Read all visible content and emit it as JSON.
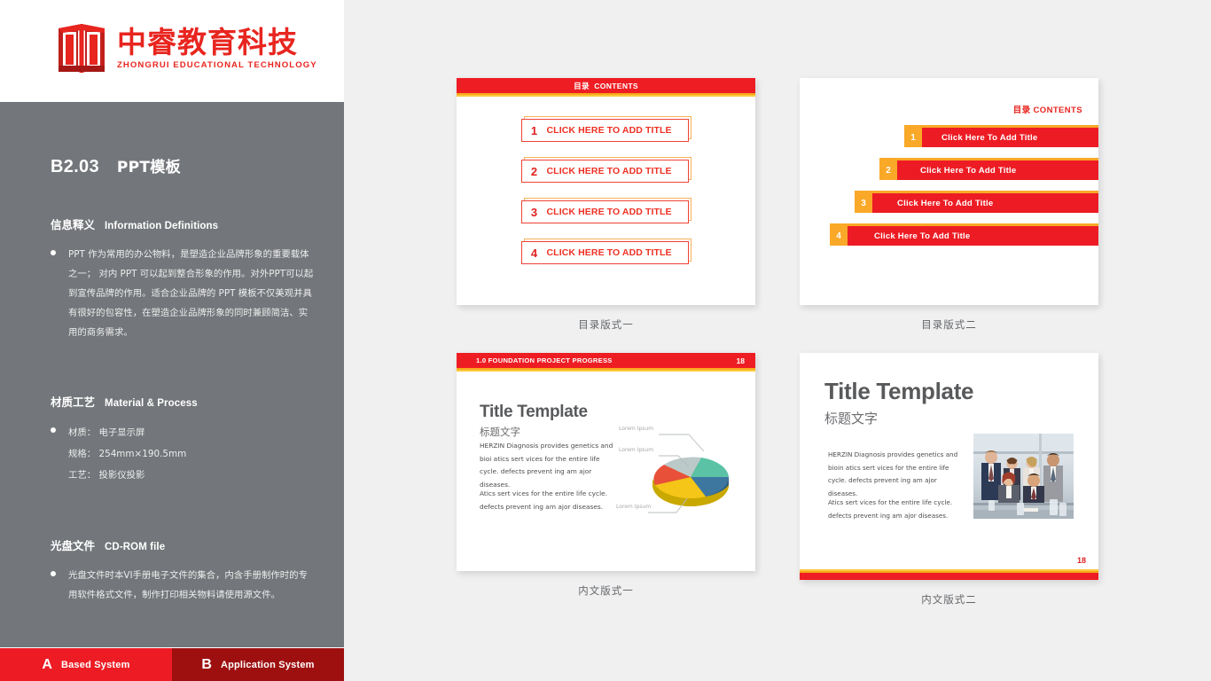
{
  "brand": {
    "logo_icon": "zhongrui-book-logo",
    "name_cn": "中睿教育科技",
    "name_en": "ZHONGRUI  EDUCATIONAL  TECHNOLOGY",
    "red": "#e8251f"
  },
  "sidebar": {
    "doc_code": "B2.03",
    "doc_title_cn": "PPT模板",
    "background": "#73767a",
    "sections": [
      {
        "title_cn": "信息释义",
        "title_en": "Information Definitions",
        "paragraph": "PPT 作为常用的办公物料，是塑造企业品牌形象的重要载体之一； 对内 PPT 可以起到整合形象的作用。对外PPT可以起到宣传品牌的作用。适合企业品牌的 PPT 模板不仅美观并具有很好的包容性，在塑造企业品牌形象的同时兼顾简洁、实用的商务需求。"
      },
      {
        "title_cn": "材质工艺",
        "title_en": "Material & Process",
        "items": [
          "材质： 电子显示屏",
          "规格： 254mm×190.5mm",
          "工艺： 投影仪投影"
        ]
      },
      {
        "title_cn": "光盘文件",
        "title_en": "CD-ROM  file",
        "paragraph": "光盘文件时本VI手册电子文件的集合，内含手册制作时的专用软件格式文件，制作打印相关物料请使用源文件。"
      }
    ]
  },
  "bottom_nav": {
    "items": [
      {
        "letter": "A",
        "label": "Based System",
        "color": "#ed1c24",
        "active": true
      },
      {
        "letter": "B",
        "label": "Application System",
        "color": "#9e1010",
        "active": false
      }
    ]
  },
  "slides": [
    {
      "caption": "目录版式一",
      "header_cn": "目录",
      "header_en": "CONTENTS",
      "items": [
        {
          "num": "1",
          "label": "CLICK HERE TO ADD TITLE"
        },
        {
          "num": "2",
          "label": "CLICK HERE TO ADD TITLE"
        },
        {
          "num": "3",
          "label": "CLICK HERE TO ADD TITLE"
        },
        {
          "num": "4",
          "label": "CLICK HERE TO ADD TITLE"
        }
      ]
    },
    {
      "caption": "目录版式二",
      "header_cn": "目录",
      "header_en": "CONTENTS",
      "items": [
        {
          "num": "1",
          "label": "Click Here To Add Title"
        },
        {
          "num": "2",
          "label": "Click Here To Add Title"
        },
        {
          "num": "3",
          "label": "Click Here To Add Title"
        },
        {
          "num": "4",
          "label": "Click Here To Add Title"
        }
      ]
    },
    {
      "caption": "内文版式一",
      "header_title": "1.0 FOUNDATION PROJECT PROGRESS",
      "page_number": "18",
      "title_en": "Title Template",
      "title_cn": "标题文字",
      "paragraph_1": "HERZIN Diagnosis provides genetics and bioi atics sert vices for the entire life cycle. defects prevent ing am ajor diseases.",
      "paragraph_2": "Atics sert vices for the entire life cycle. defects prevent ing am ajor diseases.",
      "chart_labels": [
        "Lorem Ipsum",
        "Lorem Ipsum",
        "Lorem Ipsum"
      ]
    },
    {
      "caption": "内文版式二",
      "page_number": "18",
      "title_en": "Title Template",
      "title_cn": "标题文字",
      "paragraph_1": "HERZIN Diagnosis provides genetics and bioin atics sert vices for the entire life cycle. defects prevent ing am ajor diseases.",
      "paragraph_2": "Atics sert vices for the entire life cycle. defects prevent ing am ajor diseases.",
      "photo_alt": "business-team-photo"
    }
  ],
  "chart_data": {
    "type": "pie",
    "title": "",
    "labels": [
      "Lorem Ipsum",
      "Lorem Ipsum",
      "Lorem Ipsum",
      "Lorem Ipsum",
      "Lorem Ipsum"
    ],
    "values": [
      18,
      12,
      20,
      32,
      18
    ],
    "colors": [
      "#bcc9c9",
      "#5bc2a6",
      "#3d77a0",
      "#f5c518",
      "#e8503a"
    ],
    "legend": "callout-lines"
  },
  "palette": {
    "red": "#ed1c24",
    "dark_red": "#9e1010",
    "gold": "#f9a828",
    "light_gold": "#fcc83d",
    "gray_panel": "#73767a",
    "page_bg": "#f0f0f0"
  }
}
